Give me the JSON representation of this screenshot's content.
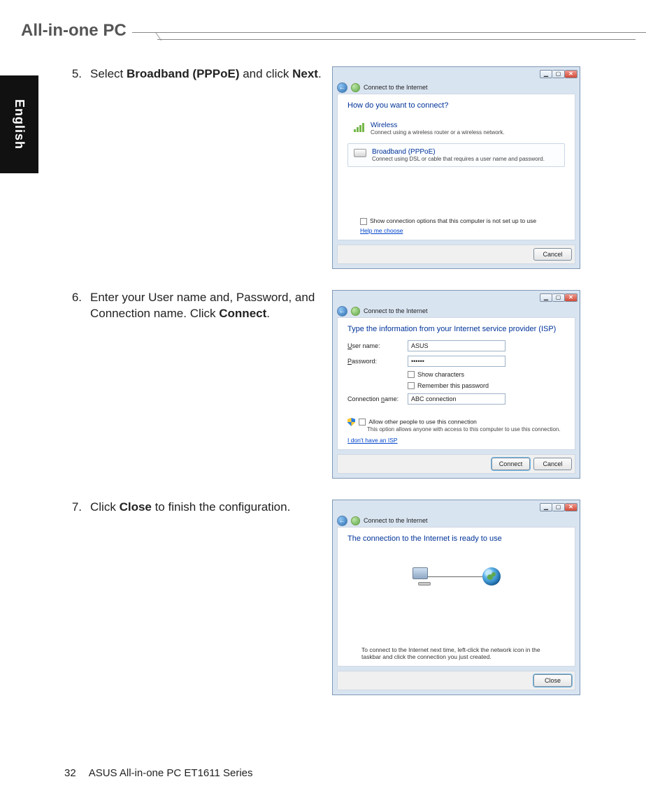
{
  "header_title": "All-in-one PC",
  "side_tab": "English",
  "steps": {
    "s5": {
      "num": "5.",
      "t1": "Select ",
      "b1": "Broadband (PPPoE)",
      "t2": " and click ",
      "b2": "Next",
      "t3": "."
    },
    "s6": {
      "num": "6.",
      "t1": "Enter your User name and, Password, and Connection name. Click ",
      "b1": "Connect",
      "t2": "."
    },
    "s7": {
      "num": "7.",
      "t1": "Click ",
      "b1": "Close",
      "t2": " to finish the configuration."
    }
  },
  "window_common": {
    "title": "Connect to the Internet",
    "min": "▁",
    "max": "▢",
    "close": "✕"
  },
  "win5": {
    "prompt": "How do you want to connect?",
    "opt_wireless_title": "Wireless",
    "opt_wireless_sub": "Connect using a wireless router or a wireless network.",
    "opt_bb_title": "Broadband (PPPoE)",
    "opt_bb_sub": "Connect using DSL or cable that requires a user name and password.",
    "show_options": "Show connection options that this computer is not set up to use",
    "help": "Help me choose",
    "cancel": "Cancel"
  },
  "win6": {
    "prompt": "Type the information from your Internet service provider (ISP)",
    "user_label_pre": "",
    "user_label_ul": "U",
    "user_label_post": "ser name:",
    "user_value": "ASUS",
    "pass_label_ul": "P",
    "pass_label_post": "assword:",
    "pass_value": "••••••",
    "show_chars_ul": "S",
    "show_chars_post": "how characters",
    "remember_ul": "R",
    "remember_post": "emember this password",
    "conn_label_pre": "Connection ",
    "conn_label_ul": "n",
    "conn_label_post": "ame:",
    "conn_value": "ABC connection",
    "allow_ul": "A",
    "allow_post": "llow other people to use this connection",
    "allow_hint": "This option allows anyone with access to this computer to use this connection.",
    "no_isp": "I don't have an ISP",
    "connect": "Connect",
    "cancel": "Cancel"
  },
  "win7": {
    "prompt": "The connection to the Internet is ready to use",
    "hint": "To connect to the Internet next time, left-click the network icon in the taskbar and click the connection you just created.",
    "close": "Close"
  },
  "footer": {
    "page": "32",
    "text": "ASUS All-in-one PC ET1611 Series"
  }
}
